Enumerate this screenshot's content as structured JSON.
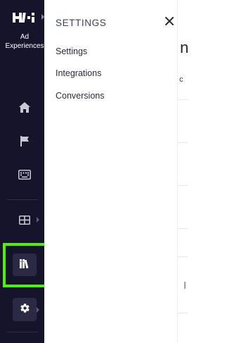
{
  "nav": {
    "app_name": "Ad\nExperiences",
    "icons": [
      "logo-icon",
      "home-icon",
      "flag-icon",
      "keyboard-icon",
      "grid-icon",
      "library-icon",
      "gear-icon"
    ],
    "highlight_color": "#4cf20a",
    "rail_color": "#15142b"
  },
  "panel": {
    "title": "SETTINGS",
    "close_label": "✕",
    "items": [
      {
        "label": "Settings"
      },
      {
        "label": "Integrations"
      },
      {
        "label": "Conversions"
      }
    ]
  },
  "peek": {
    "heading_fragment": "n",
    "sub_fragment": "c"
  }
}
